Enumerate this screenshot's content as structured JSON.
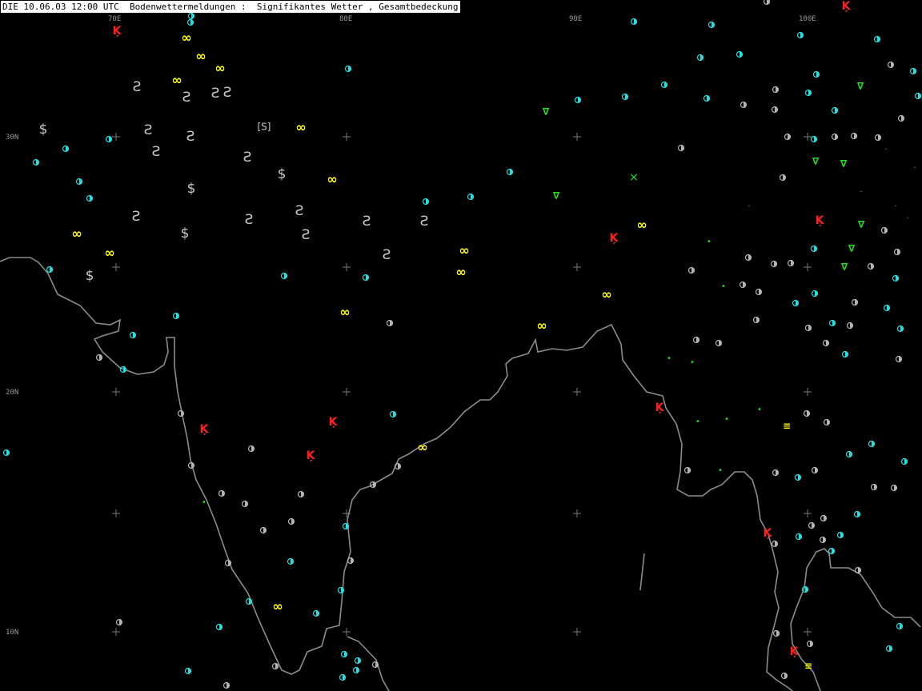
{
  "title": "DIE 10.06.03 12:00 UTC  Bodenwettermeldungen :  Signifikantes Wetter , Gesamtbedeckung",
  "grid_labels": {
    "lon_70": "70E",
    "lon_80": "80E",
    "lon_90": "90E",
    "lon_100": "100E",
    "lat_30": "30N",
    "lat_20": "20N",
    "lat_10": "10N"
  },
  "colors": {
    "haze": "#ffff00",
    "thunder": "#ff2020",
    "shower": "#20e020",
    "dust": "#c8c8c8",
    "cloud_cyan": "#20e0e0",
    "cloud_gray": "#b4b4b4",
    "coastline": "#8c8c8c",
    "grid": "#7a7a7a"
  },
  "symbol_legend": {
    "haze": "infinity-icon",
    "thunderstorm": "thunder-icon",
    "shower": "shower-icon",
    "dust": "dust-icon",
    "fog": "fog-icon",
    "cloud_cover": "cloud-cover-circle-icon"
  }
}
